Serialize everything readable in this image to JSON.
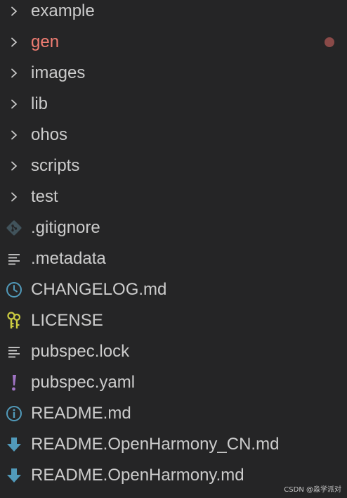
{
  "explorer": {
    "items": [
      {
        "label": "example",
        "kind": "folder",
        "icon": "chevron-right-icon"
      },
      {
        "label": "gen",
        "kind": "folder",
        "icon": "chevron-right-icon",
        "modified": true,
        "modified_color": "#f07d72"
      },
      {
        "label": "images",
        "kind": "folder",
        "icon": "chevron-right-icon"
      },
      {
        "label": "lib",
        "kind": "folder",
        "icon": "chevron-right-icon"
      },
      {
        "label": "ohos",
        "kind": "folder",
        "icon": "chevron-right-icon"
      },
      {
        "label": "scripts",
        "kind": "folder",
        "icon": "chevron-right-icon"
      },
      {
        "label": "test",
        "kind": "folder",
        "icon": "chevron-right-icon"
      },
      {
        "label": ".gitignore",
        "kind": "file",
        "icon": "git-icon"
      },
      {
        "label": ".metadata",
        "kind": "file",
        "icon": "text-lines-icon"
      },
      {
        "label": "CHANGELOG.md",
        "kind": "file",
        "icon": "clock-icon"
      },
      {
        "label": "LICENSE",
        "kind": "file",
        "icon": "key-icon"
      },
      {
        "label": "pubspec.lock",
        "kind": "file",
        "icon": "text-lines-icon"
      },
      {
        "label": "pubspec.yaml",
        "kind": "file",
        "icon": "exclamation-icon"
      },
      {
        "label": "README.md",
        "kind": "file",
        "icon": "info-icon"
      },
      {
        "label": "README.OpenHarmony_CN.md",
        "kind": "file",
        "icon": "download-arrow-icon"
      },
      {
        "label": "README.OpenHarmony.md",
        "kind": "file",
        "icon": "download-arrow-icon"
      }
    ]
  },
  "watermark": "CSDN @淼学派对",
  "colors": {
    "background": "#252526",
    "text": "#cccccc",
    "modified": "#f07d72",
    "modified_dot": "#8a4a48",
    "git_icon": "#41535b",
    "clock_icon": "#519aba",
    "key_icon": "#cbcb41",
    "yaml_icon": "#a074c4",
    "info_icon": "#519aba",
    "download_icon": "#519aba"
  }
}
